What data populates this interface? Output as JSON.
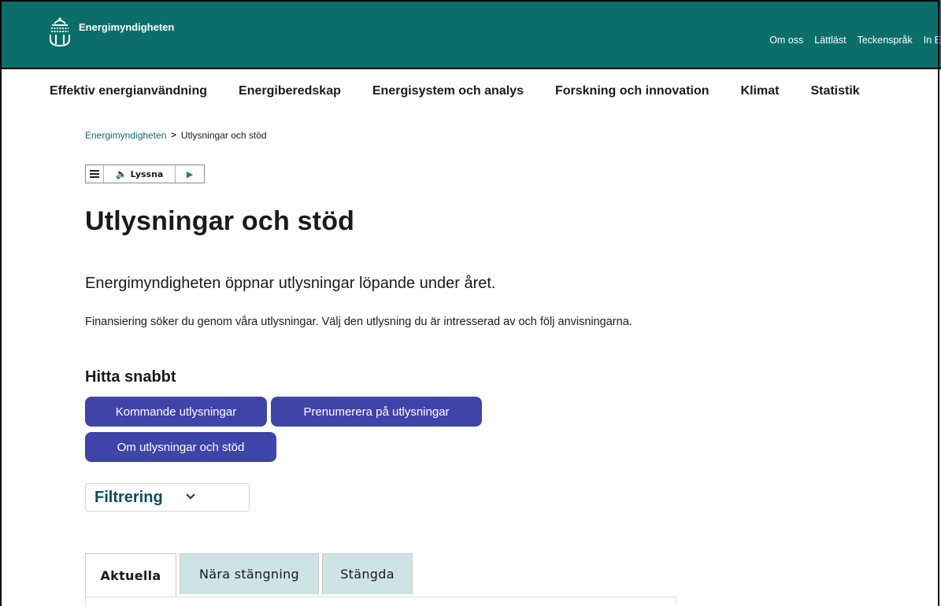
{
  "header": {
    "logo_text": "Energimyndigheten",
    "links": [
      "Om oss",
      "Lättläst",
      "Teckenspråk",
      "In E"
    ]
  },
  "nav": {
    "items": [
      "Effektiv energianvändning",
      "Energiberedskap",
      "Energisystem och analys",
      "Forskning och innovation",
      "Klimat",
      "Statistik"
    ]
  },
  "breadcrumb": {
    "home": "Energimyndigheten",
    "current": "Utlysningar och stöd"
  },
  "listen": {
    "label": "Lyssna"
  },
  "page": {
    "title": "Utlysningar och stöd",
    "lead": "Energimyndigheten öppnar utlysningar löpande under året.",
    "body": "Finansiering söker du genom våra utlysningar. Välj den utlysning du är intresserad av och följ anvisningarna.",
    "quick_heading": "Hitta snabbt"
  },
  "quick_links": [
    "Kommande utlysningar",
    "Prenumerera på utlysningar",
    "Om utlysningar och stöd"
  ],
  "filter": {
    "label": "Filtrering"
  },
  "tabs": [
    "Aktuella",
    "Nära stängning",
    "Stängda"
  ],
  "colors": {
    "header_bg": "#0b6e6a",
    "button_bg": "#3f44a8",
    "tab_inactive_bg": "#cde4e6",
    "filter_text": "#0f4b5b"
  }
}
